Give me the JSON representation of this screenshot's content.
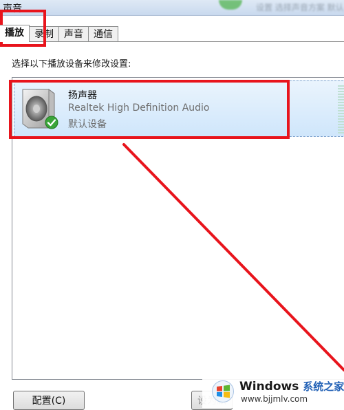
{
  "window": {
    "title": "声音",
    "blurred_title_text": "设置 选择声音方案 默认"
  },
  "tabs": [
    {
      "label": "播放",
      "active": true
    },
    {
      "label": "录制",
      "active": false
    },
    {
      "label": "声音",
      "active": false
    },
    {
      "label": "通信",
      "active": false
    }
  ],
  "instruction": "选择以下播放设备来修改设置:",
  "devices": [
    {
      "name": "扬声器",
      "description": "Realtek High Definition Audio",
      "status": "默认设备",
      "icon": "speaker-icon",
      "badge_icon": "default-check-icon"
    }
  ],
  "buttons": {
    "configure": "配置(C)",
    "set_default": "设为默认值"
  },
  "watermark": {
    "brand": "Windows",
    "brand_cn": "系统之家",
    "url": "www.bjjmlv.com"
  },
  "colors": {
    "annotation_red": "#e8141c",
    "selection_bg": "#cfe6fb",
    "check_green": "#3aa53a"
  }
}
